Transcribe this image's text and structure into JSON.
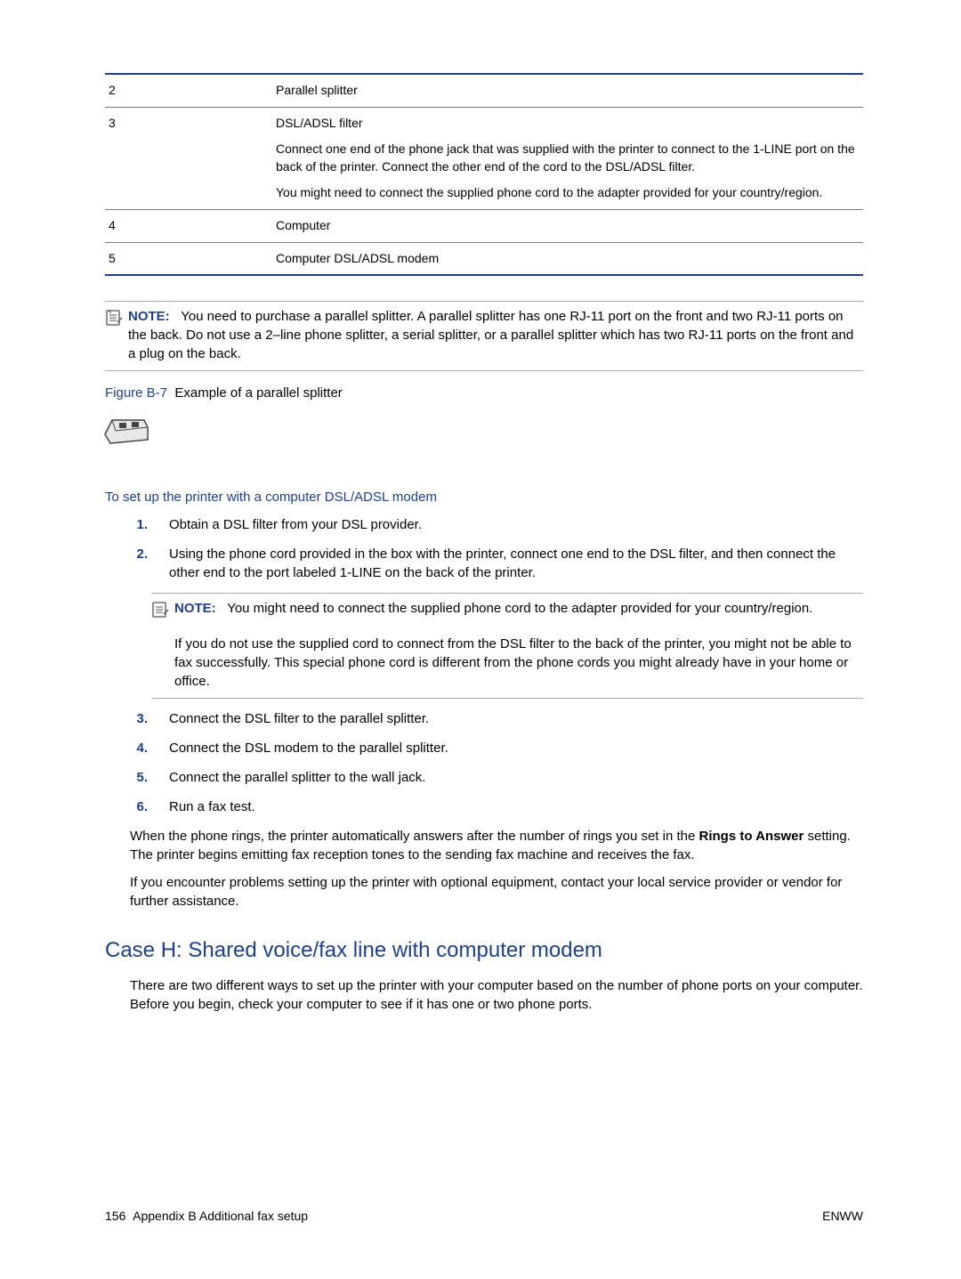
{
  "table": {
    "rows": [
      {
        "num": "2",
        "content": "Parallel splitter"
      },
      {
        "num": "3",
        "content": {
          "line1": "DSL/ADSL filter",
          "line2": "Connect one end of the phone jack that was supplied with the printer to connect to the 1-LINE port on the back of the printer. Connect the other end of the cord to the DSL/ADSL filter.",
          "line3": "You might need to connect the supplied phone cord to the adapter provided for your country/region."
        }
      },
      {
        "num": "4",
        "content": "Computer"
      },
      {
        "num": "5",
        "content": "Computer DSL/ADSL modem"
      }
    ]
  },
  "note1": {
    "label": "NOTE:",
    "text": "You need to purchase a parallel splitter. A parallel splitter has one RJ-11 port on the front and two RJ-11 ports on the back. Do not use a 2–line phone splitter, a serial splitter, or a parallel splitter which has two RJ-11 ports on the front and a plug on the back."
  },
  "figure": {
    "label": "Figure B-7",
    "caption": "Example of a parallel splitter"
  },
  "subhead": "To set up the printer with a computer DSL/ADSL modem",
  "steps": {
    "s1": {
      "num": "1.",
      "text": "Obtain a DSL filter from your DSL provider."
    },
    "s2": {
      "num": "2.",
      "text": "Using the phone cord provided in the box with the printer, connect one end to the DSL filter, and then connect the other end to the port labeled 1-LINE on the back of the printer."
    },
    "s3": {
      "num": "3.",
      "text": "Connect the DSL filter to the parallel splitter."
    },
    "s4": {
      "num": "4.",
      "text": "Connect the DSL modem to the parallel splitter."
    },
    "s5": {
      "num": "5.",
      "text": "Connect the parallel splitter to the wall jack."
    },
    "s6": {
      "num": "6.",
      "text": "Run a fax test."
    }
  },
  "inner_note": {
    "label": "NOTE:",
    "text": "You might need to connect the supplied phone cord to the adapter provided for your country/region.",
    "extra": "If you do not use the supplied cord to connect from the DSL filter to the back of the printer, you might not be able to fax successfully. This special phone cord is different from the phone cords you might already have in your home or office."
  },
  "para1_pre": "When the phone rings, the printer automatically answers after the number of rings you set in the ",
  "para1_bold": "Rings to Answer",
  "para1_post": " setting. The printer begins emitting fax reception tones to the sending fax machine and receives the fax.",
  "para2": "If you encounter problems setting up the printer with optional equipment, contact your local service provider or vendor for further assistance.",
  "case_h": "Case H: Shared voice/fax line with computer modem",
  "case_h_text": "There are two different ways to set up the printer with your computer based on the number of phone ports on your computer. Before you begin, check your computer to see if it has one or two phone ports.",
  "footer": {
    "page": "156",
    "appendix": "Appendix B   Additional fax setup",
    "right": "ENWW"
  }
}
